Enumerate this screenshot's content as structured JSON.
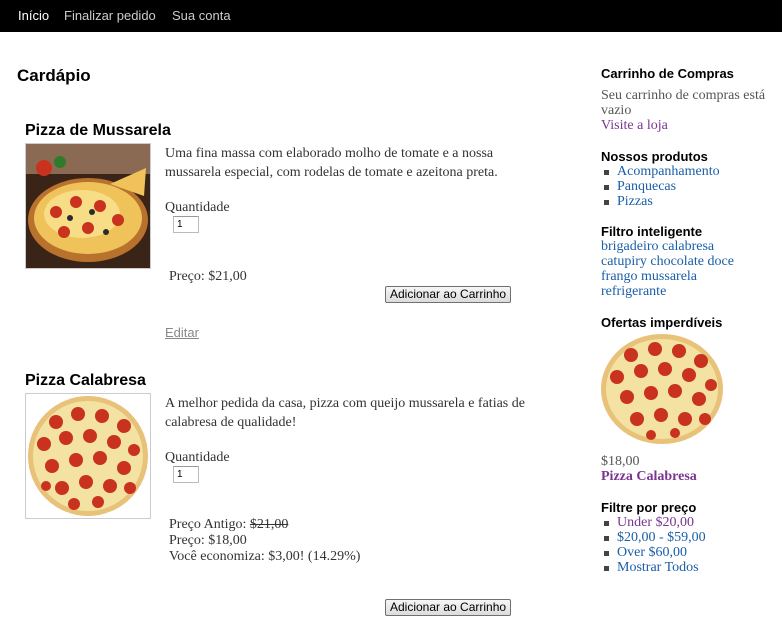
{
  "nav": {
    "items": [
      "Início",
      "Finalizar pedido",
      "Sua conta"
    ]
  },
  "main": {
    "title": "Cardápio",
    "products": [
      {
        "name": "Pizza de Mussarela",
        "description": "Uma fina massa com elaborado molho de tomate e a nossa mussarela especial, com rodelas de tomate e azeitona preta.",
        "quantity_label": "Quantidade",
        "quantity": "1",
        "price_line": "Preço: $21,00",
        "add_button": "Adicionar ao Carrinho",
        "edit_link": "Editar"
      },
      {
        "name": "Pizza Calabresa",
        "description": "A melhor pedida da casa, pizza com queijo mussarela e fatias de calabresa de qualidade!",
        "quantity_label": "Quantidade",
        "quantity": "1",
        "old_price_label": "Preço Antigo:",
        "old_price": "$21,00",
        "price_line": "Preço: $18,00",
        "savings_line": "Você economiza: $3,00! (14.29%)",
        "add_button": "Adicionar ao Carrinho"
      }
    ]
  },
  "sidebar": {
    "cart": {
      "title": "Carrinho de Compras",
      "empty_text": "Seu carrinho de compras está vazio",
      "visit_link": "Visite a loja"
    },
    "products": {
      "title": "Nossos produtos",
      "items": [
        "Acompanhamento",
        "Panquecas",
        "Pizzas"
      ]
    },
    "tags": {
      "title": "Filtro inteligente",
      "lines": [
        "brigadeiro calabresa",
        "catupiry chocolate doce",
        "frango mussarela",
        "refrigerante"
      ]
    },
    "offers": {
      "title": "Ofertas imperdíveis",
      "price": "$18,00",
      "name": "Pizza Calabresa"
    },
    "price_filter": {
      "title": "Filtre por preço",
      "items": [
        "Under $20,00",
        "$20,00 - $59,00",
        "Over $60,00",
        "Mostrar Todos"
      ]
    }
  },
  "colors": {
    "topbar": "#000000",
    "link": "#1a5ea8",
    "visited_link": "#7a3590"
  }
}
